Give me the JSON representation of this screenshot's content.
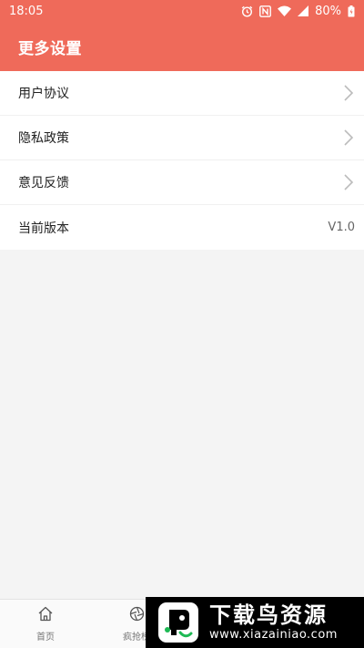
{
  "status_bar": {
    "time": "18:05",
    "battery": "80%",
    "icons": [
      "alarm-icon",
      "nfc-icon",
      "wifi-icon",
      "signal-icon",
      "battery-icon"
    ]
  },
  "header": {
    "title": "更多设置",
    "background_color": "#ef6a5a"
  },
  "settings": {
    "items": [
      {
        "label": "用户协议",
        "icon": "chevron-right-icon"
      },
      {
        "label": "隐私政策",
        "icon": "chevron-right-icon"
      },
      {
        "label": "意见反馈",
        "icon": "chevron-right-icon"
      },
      {
        "label": "当前版本",
        "value": "V1.0"
      }
    ]
  },
  "bottom_nav": {
    "items": [
      {
        "label": "首页",
        "icon": "home-icon"
      },
      {
        "label": "疯抢榜",
        "icon": "aperture-icon"
      }
    ]
  },
  "watermark": {
    "title": "下载鸟资源",
    "url": "www.xiazainiao.com"
  }
}
